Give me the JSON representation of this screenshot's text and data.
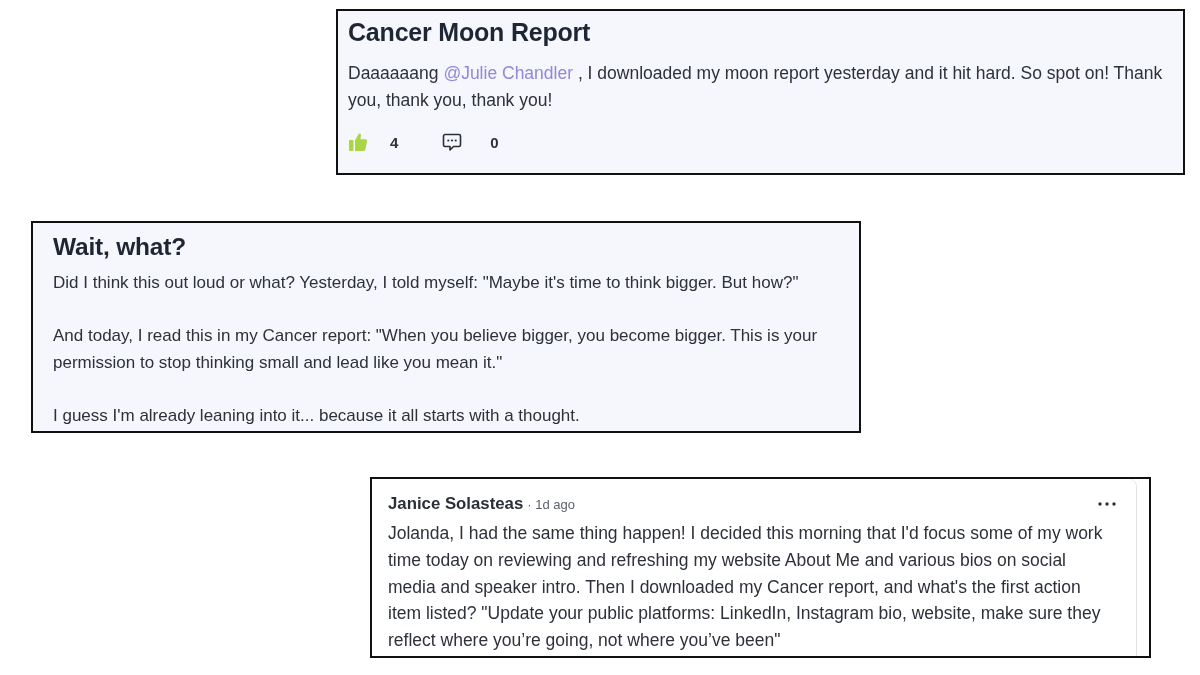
{
  "posts": [
    {
      "kind": "post",
      "title": "Cancer Moon Report",
      "body_before": "Daaaaaang ",
      "mention": "@Julie Chandler",
      "body_after": " , I downloaded my moon report yesterday and it hit hard. So spot on! Thank you, thank you, thank you!",
      "liked": true,
      "likes": "4",
      "comments": "0"
    },
    {
      "kind": "post",
      "title": "Wait, what?",
      "paragraphs": [
        "Did I think this out loud or what? Yesterday, I told myself: \"Maybe it's time to think bigger. But how?\"",
        "And today, I read this in my Cancer report: \"When you believe bigger, you become bigger. This is your permission to stop thinking small and lead like you mean it.\"",
        "I guess I'm already leaning into it... because it all starts with a thought."
      ]
    },
    {
      "kind": "comment",
      "author": "Janice Solasteas",
      "time": "· 1d ago",
      "body": "Jolanda, I had the same thing happen! I decided this morning that I'd focus some of my work time today on reviewing and refreshing my website About Me and various bios on social media and speaker intro. Then I downloaded my Cancer report, and what's the first action item listed? \"Update your public platforms: LinkedIn, Instagram bio, website, make sure they reflect where you’re going, not where you’ve been\""
    }
  ]
}
